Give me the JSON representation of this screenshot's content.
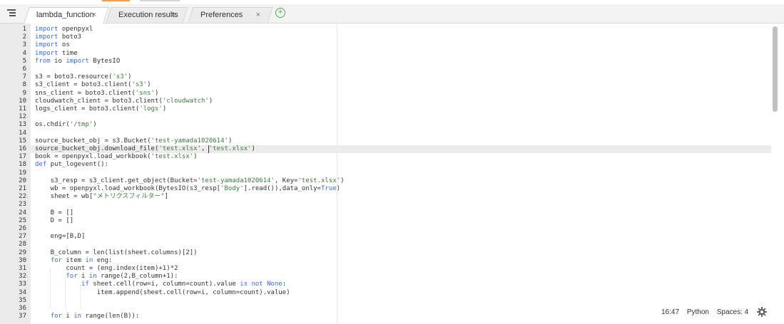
{
  "tabs": [
    {
      "label": "lambda_function",
      "close": "×",
      "active": true
    },
    {
      "label": "Execution results",
      "close": "×",
      "active": false
    },
    {
      "label": "Preferences",
      "close": "×",
      "active": false
    }
  ],
  "add_tab": "+",
  "status": {
    "position": "16:47",
    "language": "Python",
    "indent": "Spaces: 4"
  },
  "icons": {
    "menu": "tab-list-icon",
    "add": "plus-circle-icon",
    "settings": "gear-icon"
  },
  "colors": {
    "keyword": "#3a6ed8",
    "string": "#3d7a3d",
    "add": "#4caf50"
  },
  "active_line": 16,
  "code_lines": [
    {
      "n": "1",
      "segs": [
        [
          "k",
          "import"
        ],
        [
          "p",
          " openpyxl"
        ]
      ]
    },
    {
      "n": "2",
      "segs": [
        [
          "k",
          "import"
        ],
        [
          "p",
          " boto3"
        ]
      ]
    },
    {
      "n": "3",
      "segs": [
        [
          "k",
          "import"
        ],
        [
          "p",
          " os"
        ]
      ]
    },
    {
      "n": "4",
      "segs": [
        [
          "k",
          "import"
        ],
        [
          "p",
          " time"
        ]
      ]
    },
    {
      "n": "5",
      "segs": [
        [
          "k",
          "from"
        ],
        [
          "p",
          " io "
        ],
        [
          "k",
          "import"
        ],
        [
          "p",
          " BytesIO"
        ]
      ]
    },
    {
      "n": "6",
      "segs": []
    },
    {
      "n": "7",
      "segs": [
        [
          "p",
          "s3 = boto3.resource("
        ],
        [
          "s",
          "'s3'"
        ],
        [
          "p",
          ")"
        ]
      ]
    },
    {
      "n": "8",
      "segs": [
        [
          "p",
          "s3_client = boto3.client("
        ],
        [
          "s",
          "'s3'"
        ],
        [
          "p",
          ")"
        ]
      ]
    },
    {
      "n": "9",
      "segs": [
        [
          "p",
          "sns_client = boto3.client("
        ],
        [
          "s",
          "'sns'"
        ],
        [
          "p",
          ")"
        ]
      ]
    },
    {
      "n": "10",
      "segs": [
        [
          "p",
          "cloudwatch_client = boto3.client("
        ],
        [
          "s",
          "'cloudwatch'"
        ],
        [
          "p",
          ")"
        ]
      ]
    },
    {
      "n": "11",
      "segs": [
        [
          "p",
          "logs_client = boto3.client("
        ],
        [
          "s",
          "'logs'"
        ],
        [
          "p",
          ")"
        ]
      ]
    },
    {
      "n": "12",
      "segs": []
    },
    {
      "n": "13",
      "segs": [
        [
          "p",
          "os.chdir("
        ],
        [
          "s",
          "'/tmp'"
        ],
        [
          "p",
          ")"
        ]
      ]
    },
    {
      "n": "14",
      "segs": []
    },
    {
      "n": "15",
      "segs": [
        [
          "p",
          "source_bucket_obj = s3.Bucket("
        ],
        [
          "s",
          "'test-yamada1020614'"
        ],
        [
          "p",
          ")"
        ]
      ]
    },
    {
      "n": "16",
      "segs": [
        [
          "p",
          "source_bucket_obj.download_file("
        ],
        [
          "s",
          "'test.xlsx'"
        ],
        [
          "p",
          ", "
        ],
        [
          "s",
          "'test.xlsx'"
        ],
        [
          "p",
          ")"
        ]
      ]
    },
    {
      "n": "17",
      "segs": [
        [
          "p",
          "book = openpyxl.load_workbook("
        ],
        [
          "s",
          "'test.xlsx'"
        ],
        [
          "p",
          ")"
        ]
      ]
    },
    {
      "n": "18",
      "segs": [
        [
          "k",
          "def"
        ],
        [
          "p",
          " put_logevent():"
        ]
      ]
    },
    {
      "n": "19",
      "segs": []
    },
    {
      "n": "20",
      "segs": [
        [
          "p",
          "    s3_resp = s3_client.get_object(Bucket="
        ],
        [
          "s",
          "'test-yamada1020614'"
        ],
        [
          "p",
          ", Key="
        ],
        [
          "s",
          "'test.xlsx'"
        ],
        [
          "p",
          ")"
        ]
      ]
    },
    {
      "n": "21",
      "segs": [
        [
          "p",
          "    wb = openpyxl.load_workbook(BytesIO(s3_resp["
        ],
        [
          "s",
          "'Body'"
        ],
        [
          "p",
          "].read()),data_only="
        ],
        [
          "k",
          "True"
        ],
        [
          "p",
          ")"
        ]
      ]
    },
    {
      "n": "22",
      "segs": [
        [
          "p",
          "    sheet = wb["
        ],
        [
          "s",
          "\"メトリクスフィルター\""
        ],
        [
          "p",
          "]"
        ]
      ]
    },
    {
      "n": "23",
      "segs": []
    },
    {
      "n": "24",
      "segs": [
        [
          "p",
          "    B = []"
        ]
      ]
    },
    {
      "n": "25",
      "segs": [
        [
          "p",
          "    D = []"
        ]
      ]
    },
    {
      "n": "26",
      "segs": []
    },
    {
      "n": "27",
      "segs": [
        [
          "p",
          "    eng=[B,D]"
        ]
      ]
    },
    {
      "n": "28",
      "segs": []
    },
    {
      "n": "29",
      "segs": [
        [
          "p",
          "    B_column = len(list(sheet.columns)[2])"
        ]
      ]
    },
    {
      "n": "30",
      "segs": [
        [
          "p",
          "    "
        ],
        [
          "k",
          "for"
        ],
        [
          "p",
          " item "
        ],
        [
          "k",
          "in"
        ],
        [
          "p",
          " eng:"
        ]
      ]
    },
    {
      "n": "31",
      "segs": [
        [
          "p",
          "        count = (eng.index(item)+1)*2"
        ]
      ]
    },
    {
      "n": "32",
      "segs": [
        [
          "p",
          "        "
        ],
        [
          "k",
          "for"
        ],
        [
          "p",
          " i "
        ],
        [
          "k",
          "in"
        ],
        [
          "p",
          " range(2,B_column+1):"
        ]
      ]
    },
    {
      "n": "33",
      "segs": [
        [
          "p",
          "            "
        ],
        [
          "k",
          "if"
        ],
        [
          "p",
          " sheet.cell(row=i, column=count).value "
        ],
        [
          "k",
          "is not None"
        ],
        [
          "p",
          ":"
        ]
      ]
    },
    {
      "n": "34",
      "segs": [
        [
          "p",
          "                item.append(sheet.cell(row=i, column=count).value)"
        ]
      ]
    },
    {
      "n": "35",
      "segs": []
    },
    {
      "n": "36",
      "segs": []
    },
    {
      "n": "37",
      "segs": [
        [
          "p",
          "    "
        ],
        [
          "k",
          "for"
        ],
        [
          "p",
          " i "
        ],
        [
          "k",
          "in"
        ],
        [
          "p",
          " range(len(B)):"
        ]
      ]
    }
  ]
}
